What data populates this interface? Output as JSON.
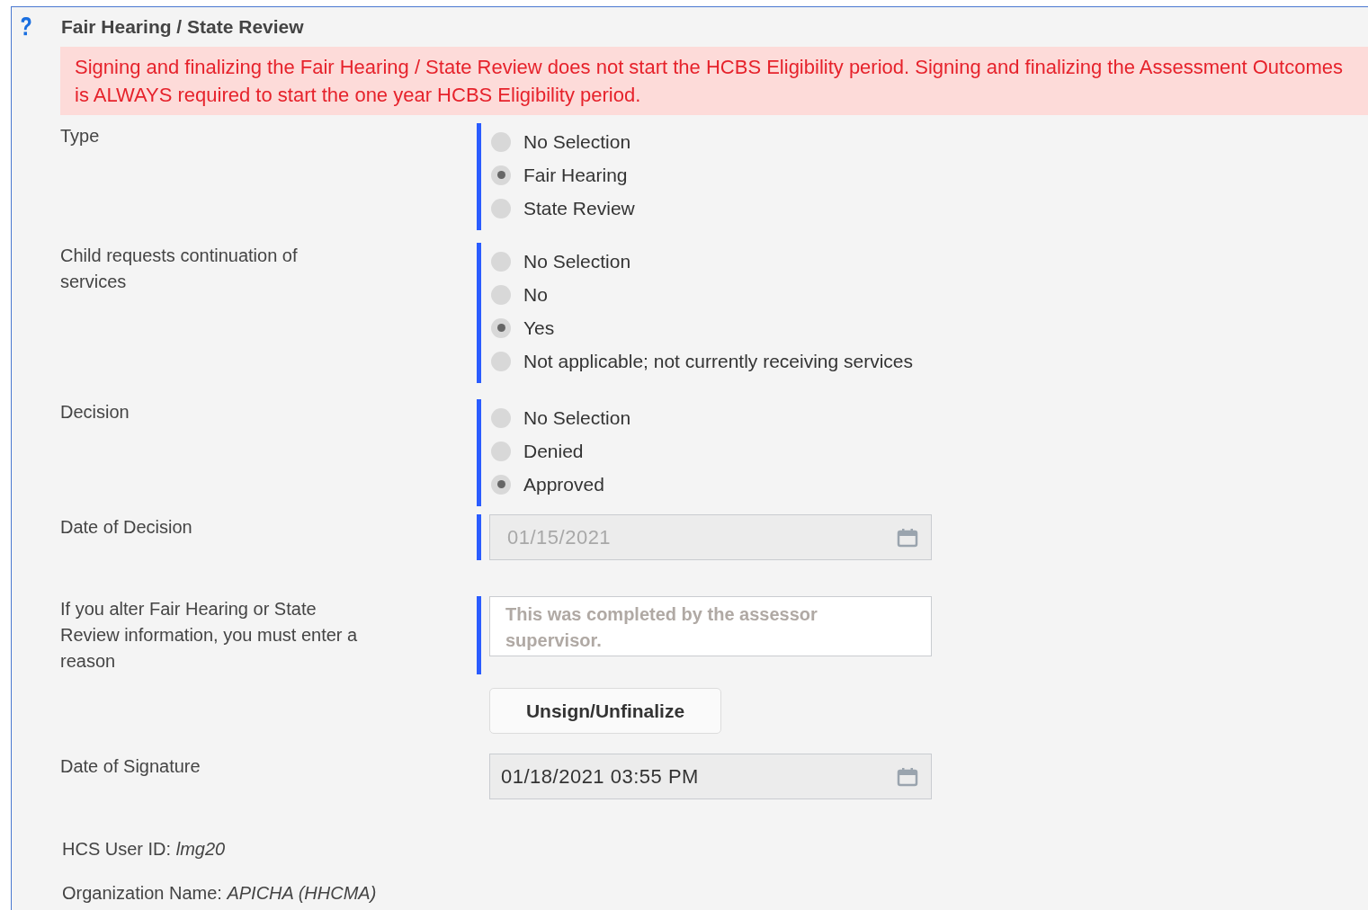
{
  "title": "Fair Hearing / State Review",
  "alert": "Signing and finalizing the Fair Hearing / State Review does not start the HCBS Eligibility period. Signing and finalizing the Assessment Outcomes is ALWAYS required to start the one year HCBS Eligibility period.",
  "fields": [
    {
      "kind": "radio",
      "label": "Type",
      "required": true,
      "options": [
        {
          "label": "No Selection",
          "selected": false
        },
        {
          "label": "Fair Hearing",
          "selected": true
        },
        {
          "label": "State Review",
          "selected": false
        }
      ]
    },
    {
      "kind": "radio",
      "label": "Child requests continuation of services",
      "required": true,
      "options": [
        {
          "label": "No Selection",
          "selected": false
        },
        {
          "label": "No",
          "selected": false
        },
        {
          "label": "Yes",
          "selected": true
        },
        {
          "label": "Not applicable; not currently receiving services",
          "selected": false
        }
      ]
    },
    {
      "kind": "radio",
      "label": "Decision",
      "required": true,
      "options": [
        {
          "label": "No Selection",
          "selected": false
        },
        {
          "label": "Denied",
          "selected": false
        },
        {
          "label": "Approved",
          "selected": true
        }
      ]
    },
    {
      "kind": "date",
      "label": "Date of Decision",
      "value": "01/15/2021",
      "disabled": true,
      "required": true
    },
    {
      "kind": "text",
      "label": "If you alter Fair Hearing or State Review information, you must enter a reason",
      "value": "This was completed by the assessor supervisor.",
      "disabled": true,
      "required": true
    },
    {
      "kind": "button",
      "label": "Unsign/Unfinalize"
    },
    {
      "kind": "date",
      "label": "Date of Signature",
      "value": "01/18/2021 03:55 PM",
      "disabled": false,
      "required": false
    }
  ],
  "info": [
    {
      "label": "HCS User ID:",
      "value": "lmg20"
    },
    {
      "label": "Organization Name:",
      "value": "APICHA (HHCMA)"
    }
  ]
}
